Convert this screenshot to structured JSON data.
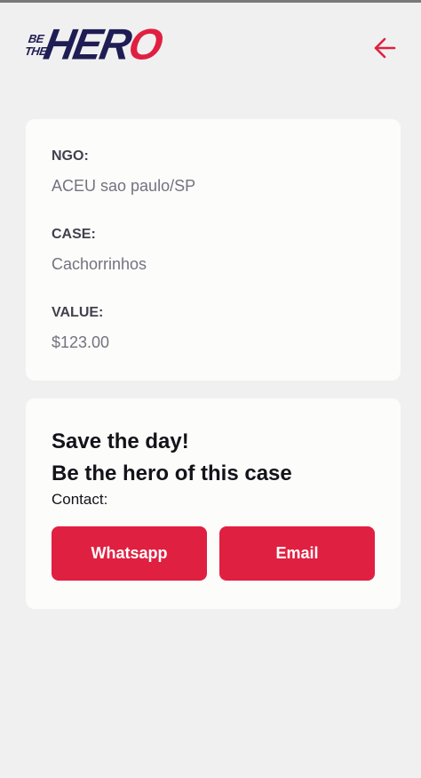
{
  "header": {
    "logo": {
      "small_top": "BE",
      "small_bottom": "THE",
      "big_dark": "HER",
      "big_red": "O"
    },
    "back_icon": "arrow-left-icon",
    "accent_color": "#e02041"
  },
  "details": {
    "ngo": {
      "label": "NGO:",
      "value": "ACEU sao paulo/SP"
    },
    "case": {
      "label": "CASE:",
      "value": "Cachorrinhos"
    },
    "value": {
      "label": "VALUE:",
      "value": "$123.00"
    }
  },
  "contact": {
    "headline_1": "Save the day!",
    "headline_2": "Be the hero of this case",
    "label": "Contact:",
    "whatsapp_label": "Whatsapp",
    "email_label": "Email"
  }
}
